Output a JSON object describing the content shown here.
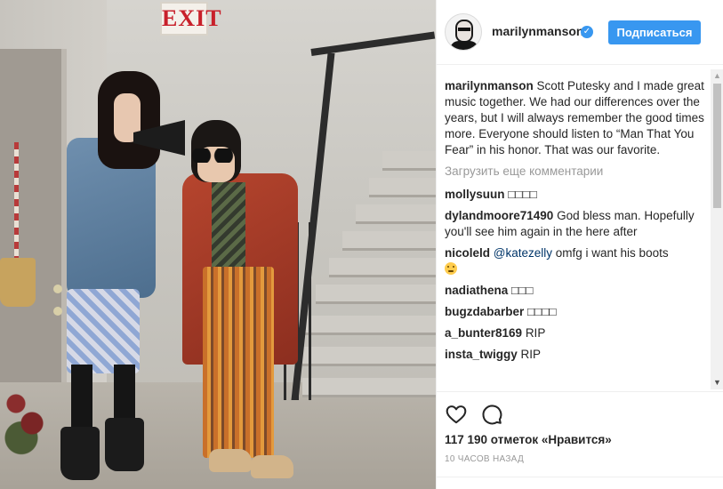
{
  "photo": {
    "exit_sign": "EXIT",
    "alt": ""
  },
  "post": {
    "author": {
      "username": "marilynmanson",
      "verified": true
    },
    "follow_label": "Подписаться",
    "caption": {
      "username": "marilynmanson",
      "text": "Scott Putesky and I made great music together. We had our differences over the years, but I will always remember the good times more. Everyone should listen to “Man That You Fear” in his honor. That was our favorite."
    },
    "load_more_label": "Загрузить еще комментарии",
    "comments": [
      {
        "username": "mollysuun",
        "text": "□□□□"
      },
      {
        "username": "dylandmoore71490",
        "text": "God bless man. Hopefully you'll see him again in the here after"
      },
      {
        "username": "nicoleld",
        "mention": "@katezelly",
        "text": " omfg i want his boots"
      },
      {
        "username": "nadiathena",
        "text": "□□□"
      },
      {
        "username": "bugzdabarber",
        "text": "□□□□"
      },
      {
        "username": "a_bunter8169",
        "text": "RIP"
      },
      {
        "username": "insta_twiggy",
        "text": "RIP"
      }
    ],
    "likes_text": "117 190 отметок «Нравится»",
    "timestamp": "10 ЧАСОВ НАЗАД"
  },
  "icons": {
    "like": "heart-icon",
    "comment": "comment-icon"
  },
  "colors": {
    "accent": "#3897f0",
    "text": "#262626",
    "muted": "#999999",
    "mention": "#003569"
  }
}
